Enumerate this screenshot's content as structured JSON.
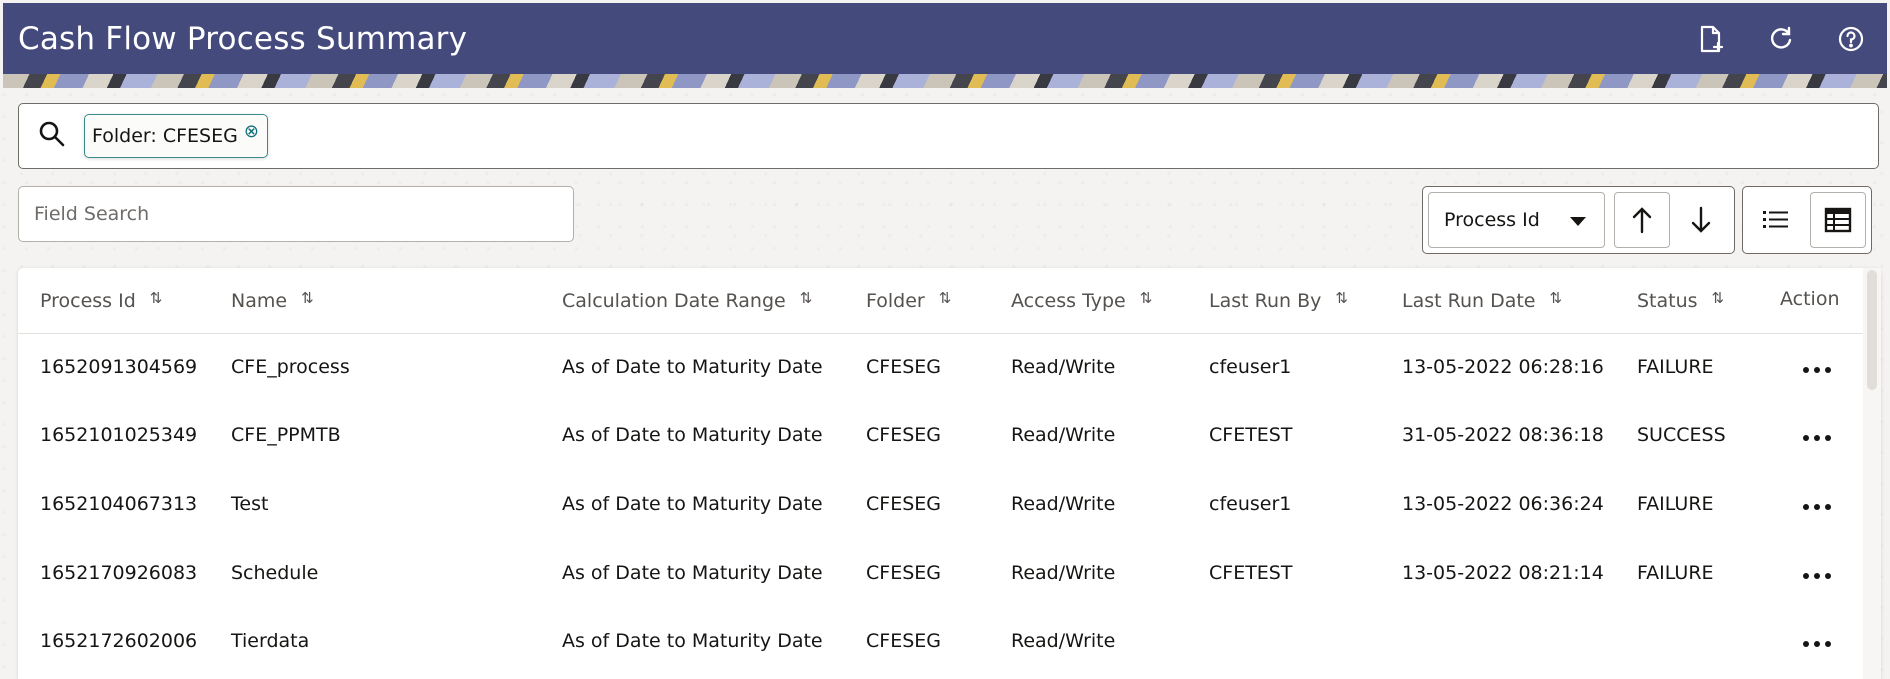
{
  "header": {
    "title": "Cash Flow Process Summary",
    "icons": [
      "new-document-icon",
      "refresh-icon",
      "help-icon"
    ]
  },
  "search": {
    "chip_label": "Folder: CFESEG",
    "chip_close": "⊗"
  },
  "field_search": {
    "placeholder": "Field Search"
  },
  "sort": {
    "selected": "Process Id",
    "ascending": "↑",
    "descending": "↓"
  },
  "table": {
    "columns": {
      "process_id": "Process Id",
      "name": "Name",
      "calc_range": "Calculation Date Range",
      "folder": "Folder",
      "access_type": "Access Type",
      "last_run_by": "Last Run By",
      "last_run_date": "Last Run Date",
      "status": "Status",
      "action": "Action"
    },
    "sort_icon": "⇅",
    "rows": [
      {
        "process_id": "1652091304569",
        "name": "CFE_process",
        "calc_range": "As of Date to Maturity Date",
        "folder": "CFESEG",
        "access_type": "Read/Write",
        "last_run_by": "cfeuser1",
        "last_run_date": "13-05-2022 06:28:16",
        "status": "FAILURE"
      },
      {
        "process_id": "1652101025349",
        "name": "CFE_PPMTB",
        "calc_range": "As of Date to Maturity Date",
        "folder": "CFESEG",
        "access_type": "Read/Write",
        "last_run_by": "CFETEST",
        "last_run_date": "31-05-2022 08:36:18",
        "status": "SUCCESS"
      },
      {
        "process_id": "1652104067313",
        "name": "Test",
        "calc_range": "As of Date to Maturity Date",
        "folder": "CFESEG",
        "access_type": "Read/Write",
        "last_run_by": "cfeuser1",
        "last_run_date": "13-05-2022 06:36:24",
        "status": "FAILURE"
      },
      {
        "process_id": "1652170926083",
        "name": "Schedule",
        "calc_range": "As of Date to Maturity Date",
        "folder": "CFESEG",
        "access_type": "Read/Write",
        "last_run_by": "CFETEST",
        "last_run_date": "13-05-2022 08:21:14",
        "status": "FAILURE"
      },
      {
        "process_id": "1652172602006",
        "name": "Tierdata",
        "calc_range": "As of Date to Maturity Date",
        "folder": "CFESEG",
        "access_type": "Read/Write",
        "last_run_by": "",
        "last_run_date": "",
        "status": ""
      }
    ]
  },
  "colors": {
    "header_bg": "#454a7d",
    "chip_border": "#3a8c8c"
  }
}
